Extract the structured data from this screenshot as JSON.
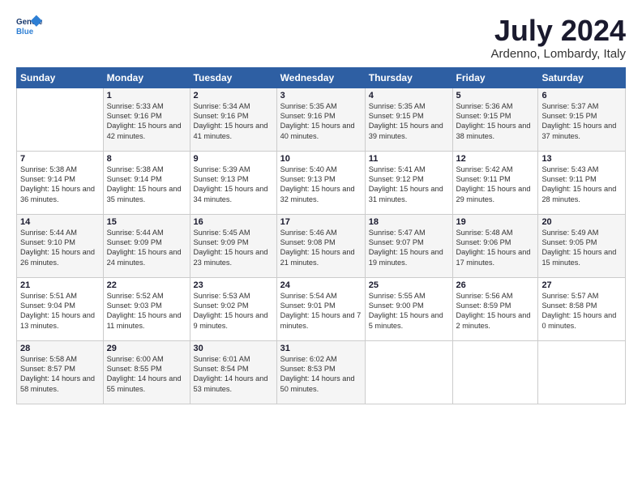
{
  "logo": {
    "line1": "General",
    "line2": "Blue"
  },
  "title": "July 2024",
  "subtitle": "Ardenno, Lombardy, Italy",
  "days_header": [
    "Sunday",
    "Monday",
    "Tuesday",
    "Wednesday",
    "Thursday",
    "Friday",
    "Saturday"
  ],
  "weeks": [
    [
      {
        "num": "",
        "info": ""
      },
      {
        "num": "1",
        "info": "Sunrise: 5:33 AM\nSunset: 9:16 PM\nDaylight: 15 hours\nand 42 minutes."
      },
      {
        "num": "2",
        "info": "Sunrise: 5:34 AM\nSunset: 9:16 PM\nDaylight: 15 hours\nand 41 minutes."
      },
      {
        "num": "3",
        "info": "Sunrise: 5:35 AM\nSunset: 9:16 PM\nDaylight: 15 hours\nand 40 minutes."
      },
      {
        "num": "4",
        "info": "Sunrise: 5:35 AM\nSunset: 9:15 PM\nDaylight: 15 hours\nand 39 minutes."
      },
      {
        "num": "5",
        "info": "Sunrise: 5:36 AM\nSunset: 9:15 PM\nDaylight: 15 hours\nand 38 minutes."
      },
      {
        "num": "6",
        "info": "Sunrise: 5:37 AM\nSunset: 9:15 PM\nDaylight: 15 hours\nand 37 minutes."
      }
    ],
    [
      {
        "num": "7",
        "info": "Sunrise: 5:38 AM\nSunset: 9:14 PM\nDaylight: 15 hours\nand 36 minutes."
      },
      {
        "num": "8",
        "info": "Sunrise: 5:38 AM\nSunset: 9:14 PM\nDaylight: 15 hours\nand 35 minutes."
      },
      {
        "num": "9",
        "info": "Sunrise: 5:39 AM\nSunset: 9:13 PM\nDaylight: 15 hours\nand 34 minutes."
      },
      {
        "num": "10",
        "info": "Sunrise: 5:40 AM\nSunset: 9:13 PM\nDaylight: 15 hours\nand 32 minutes."
      },
      {
        "num": "11",
        "info": "Sunrise: 5:41 AM\nSunset: 9:12 PM\nDaylight: 15 hours\nand 31 minutes."
      },
      {
        "num": "12",
        "info": "Sunrise: 5:42 AM\nSunset: 9:11 PM\nDaylight: 15 hours\nand 29 minutes."
      },
      {
        "num": "13",
        "info": "Sunrise: 5:43 AM\nSunset: 9:11 PM\nDaylight: 15 hours\nand 28 minutes."
      }
    ],
    [
      {
        "num": "14",
        "info": "Sunrise: 5:44 AM\nSunset: 9:10 PM\nDaylight: 15 hours\nand 26 minutes."
      },
      {
        "num": "15",
        "info": "Sunrise: 5:44 AM\nSunset: 9:09 PM\nDaylight: 15 hours\nand 24 minutes."
      },
      {
        "num": "16",
        "info": "Sunrise: 5:45 AM\nSunset: 9:09 PM\nDaylight: 15 hours\nand 23 minutes."
      },
      {
        "num": "17",
        "info": "Sunrise: 5:46 AM\nSunset: 9:08 PM\nDaylight: 15 hours\nand 21 minutes."
      },
      {
        "num": "18",
        "info": "Sunrise: 5:47 AM\nSunset: 9:07 PM\nDaylight: 15 hours\nand 19 minutes."
      },
      {
        "num": "19",
        "info": "Sunrise: 5:48 AM\nSunset: 9:06 PM\nDaylight: 15 hours\nand 17 minutes."
      },
      {
        "num": "20",
        "info": "Sunrise: 5:49 AM\nSunset: 9:05 PM\nDaylight: 15 hours\nand 15 minutes."
      }
    ],
    [
      {
        "num": "21",
        "info": "Sunrise: 5:51 AM\nSunset: 9:04 PM\nDaylight: 15 hours\nand 13 minutes."
      },
      {
        "num": "22",
        "info": "Sunrise: 5:52 AM\nSunset: 9:03 PM\nDaylight: 15 hours\nand 11 minutes."
      },
      {
        "num": "23",
        "info": "Sunrise: 5:53 AM\nSunset: 9:02 PM\nDaylight: 15 hours\nand 9 minutes."
      },
      {
        "num": "24",
        "info": "Sunrise: 5:54 AM\nSunset: 9:01 PM\nDaylight: 15 hours\nand 7 minutes."
      },
      {
        "num": "25",
        "info": "Sunrise: 5:55 AM\nSunset: 9:00 PM\nDaylight: 15 hours\nand 5 minutes."
      },
      {
        "num": "26",
        "info": "Sunrise: 5:56 AM\nSunset: 8:59 PM\nDaylight: 15 hours\nand 2 minutes."
      },
      {
        "num": "27",
        "info": "Sunrise: 5:57 AM\nSunset: 8:58 PM\nDaylight: 15 hours\nand 0 minutes."
      }
    ],
    [
      {
        "num": "28",
        "info": "Sunrise: 5:58 AM\nSunset: 8:57 PM\nDaylight: 14 hours\nand 58 minutes."
      },
      {
        "num": "29",
        "info": "Sunrise: 6:00 AM\nSunset: 8:55 PM\nDaylight: 14 hours\nand 55 minutes."
      },
      {
        "num": "30",
        "info": "Sunrise: 6:01 AM\nSunset: 8:54 PM\nDaylight: 14 hours\nand 53 minutes."
      },
      {
        "num": "31",
        "info": "Sunrise: 6:02 AM\nSunset: 8:53 PM\nDaylight: 14 hours\nand 50 minutes."
      },
      {
        "num": "",
        "info": ""
      },
      {
        "num": "",
        "info": ""
      },
      {
        "num": "",
        "info": ""
      }
    ]
  ]
}
